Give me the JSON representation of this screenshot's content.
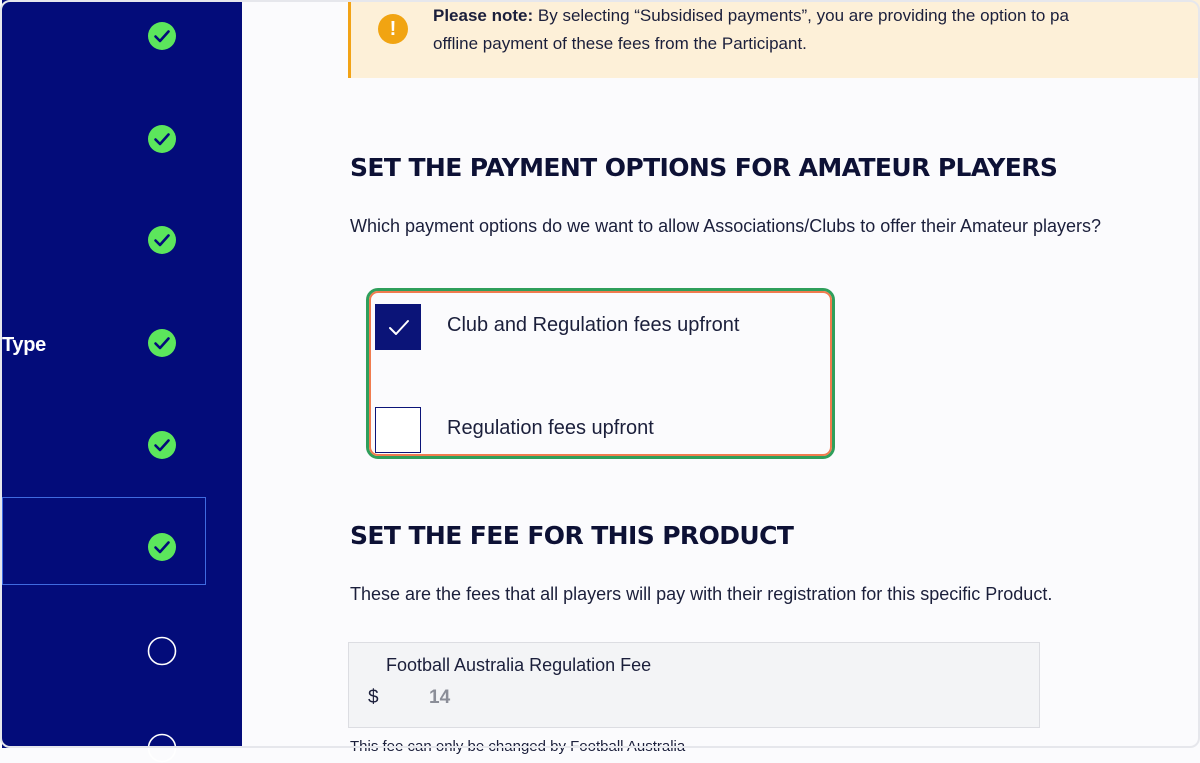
{
  "sidebar": {
    "partial_label": "Type",
    "steps": [
      {
        "status": "complete"
      },
      {
        "status": "complete"
      },
      {
        "status": "complete"
      },
      {
        "status": "complete"
      },
      {
        "status": "complete"
      },
      {
        "status": "complete",
        "active": true
      },
      {
        "status": "incomplete"
      },
      {
        "status": "incomplete"
      }
    ],
    "icons": {
      "complete": "check-circle-icon",
      "incomplete": "empty-circle-icon"
    },
    "colors": {
      "background": "#030c7a",
      "complete": "#5ce65c",
      "active_border": "#3f6be0"
    }
  },
  "notice": {
    "icon": "exclamation-icon",
    "bold_prefix": "Please note:",
    "line1": " By selecting “Subsidised payments”, you are providing the option to pa",
    "line2": "offline payment of these fees from the Participant.",
    "colors": {
      "background": "#fdf0d8",
      "accent": "#f2a316"
    }
  },
  "payment_section": {
    "heading": "SET THE PAYMENT OPTIONS FOR AMATEUR PLAYERS",
    "description": "Which payment options do we want to allow Associations/Clubs to offer their Amateur players?",
    "options": [
      {
        "label": "Club and Regulation fees upfront",
        "checked": true
      },
      {
        "label": "Regulation fees upfront",
        "checked": false
      }
    ]
  },
  "fee_section": {
    "heading": "SET THE FEE FOR THIS PRODUCT",
    "description": "These are the fees that all players will pay with their registration for this specific Product.",
    "fee_label": "Football Australia Regulation Fee",
    "currency": "$",
    "value": "14",
    "note": "This fee can only be changed by Football Australia"
  }
}
